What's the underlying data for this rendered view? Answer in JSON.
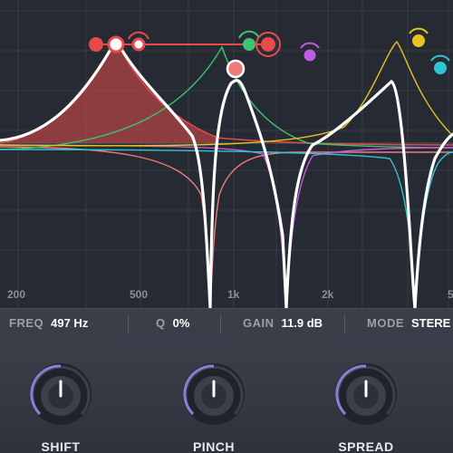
{
  "graph": {
    "freq_labels": [
      "200",
      "500",
      "1k",
      "2k",
      "5"
    ]
  },
  "params": {
    "freq": {
      "label": "FREQ",
      "value": "497 Hz"
    },
    "q": {
      "label": "Q",
      "value": "0%"
    },
    "gain": {
      "label": "GAIN",
      "value": "11.9 dB"
    },
    "mode": {
      "label": "MODE",
      "value": "STERE"
    }
  },
  "knobs": [
    {
      "label": "SHIFT"
    },
    {
      "label": "PINCH"
    },
    {
      "label": "SPREAD"
    }
  ],
  "colors": {
    "band_red": "#e84a4a",
    "band_green": "#3ec46d",
    "band_purple": "#c05ce0",
    "band_yellow": "#e8c21f",
    "band_cyan": "#2fc6d4",
    "band_salmon": "#f07a7a"
  }
}
